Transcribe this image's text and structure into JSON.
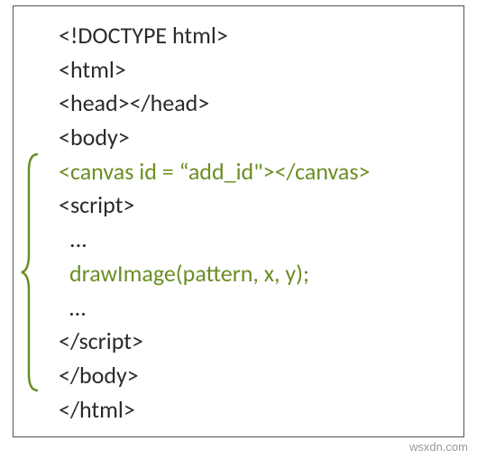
{
  "code": {
    "l1": "<!DOCTYPE html>",
    "l2": "<html>",
    "l3": "<head></head>",
    "l4": "<body>",
    "l5": "<canvas id = “add_id\"></canvas>",
    "l6": "<script>",
    "l7": "...",
    "l8": "drawImage(pattern, x, y);",
    "l9": "…",
    "l10": "</script>",
    "l11": "</body>",
    "l12": "</html>"
  },
  "footer": "wsxdn.com"
}
